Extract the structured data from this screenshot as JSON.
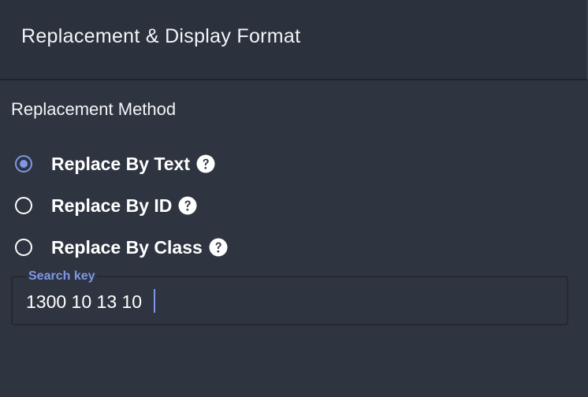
{
  "header": {
    "title": "Replacement & Display Format"
  },
  "replacement": {
    "section_title": "Replacement Method",
    "options": [
      {
        "label": "Replace By Text",
        "selected": true,
        "help_icon": "question-circle-icon"
      },
      {
        "label": "Replace By ID",
        "selected": false,
        "help_icon": "question-circle-icon"
      },
      {
        "label": "Replace By Class",
        "selected": false,
        "help_icon": "question-circle-icon"
      }
    ]
  },
  "search": {
    "label": "Search key",
    "value": "1300 10 13 10"
  },
  "colors": {
    "background": "#2e3440",
    "header_background": "#2c323d",
    "accent": "#7f97e6",
    "text": "#ffffff"
  }
}
